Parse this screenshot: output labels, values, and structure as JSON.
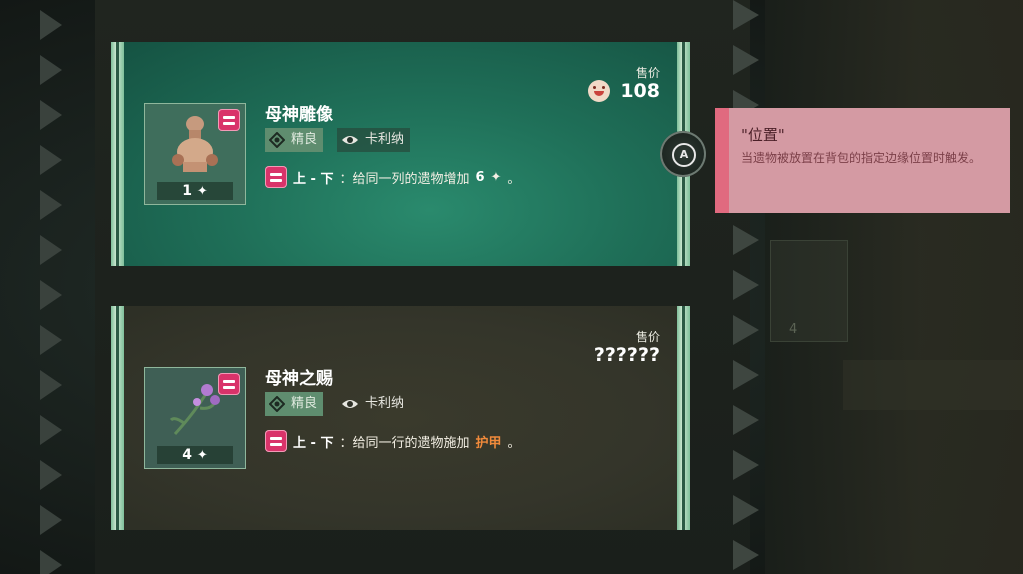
{
  "cards": [
    {
      "name": "母神雕像",
      "count": "1",
      "rarity": "精良",
      "character": "卡利纳",
      "effect_prefix": "上 - 下",
      "effect_text": "：给同一列的遗物增加",
      "effect_value": "6",
      "effect_suffix": "。",
      "price_label": "售价",
      "price": "108"
    },
    {
      "name": "母神之赐",
      "count": "4",
      "rarity": "精良",
      "character": "卡利纳",
      "effect_prefix": "上 - 下",
      "effect_text": "：给同一行的遗物施加",
      "effect_highlight": "护甲",
      "effect_suffix": "。",
      "price_label": "售价",
      "price": "??????"
    }
  ],
  "a_button": {
    "label": "A"
  },
  "tooltip": {
    "title": "\"位置\"",
    "body": "当遗物被放置在背包的指定边缘位置时触发。"
  },
  "ghost_card": {
    "count": "4"
  },
  "colors": {
    "card1_bg": "#1f6f58",
    "card2_bg": "#34352a",
    "rail": "#7fbf9a",
    "badge": "#d9336a",
    "tooltip_bg": "#d49aa3",
    "armor": "#f08a3b"
  },
  "icons": [
    "coin-face-icon",
    "rarity-icon",
    "eye-character-icon",
    "sparkle-icon",
    "a-button-icon",
    "statue-icon",
    "flower-icon"
  ]
}
